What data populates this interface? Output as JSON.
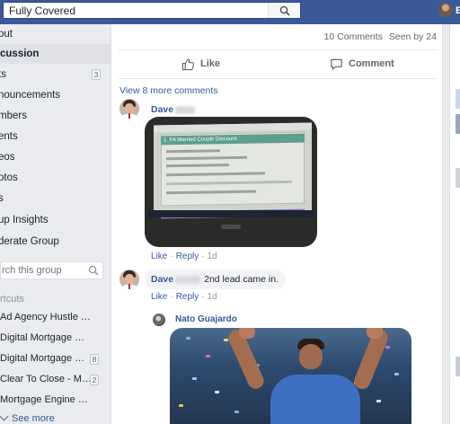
{
  "topbar": {
    "search_value": "Fully Covered",
    "profile_initial": "E"
  },
  "sidebar": {
    "items": [
      {
        "label": "out",
        "count": ""
      },
      {
        "label": "cussion",
        "count": "",
        "active": true
      },
      {
        "label": "ts",
        "count": "3"
      },
      {
        "label": "nouncements",
        "count": ""
      },
      {
        "label": "mbers",
        "count": ""
      },
      {
        "label": "ents",
        "count": ""
      },
      {
        "label": "eos",
        "count": ""
      },
      {
        "label": "otos",
        "count": ""
      },
      {
        "label": "s",
        "count": ""
      },
      {
        "label": "up Insights",
        "count": ""
      },
      {
        "label": "derate Group",
        "count": ""
      }
    ],
    "search_placeholder": "rch this group",
    "shortcuts_title": "rtcuts",
    "shortcuts": [
      {
        "label": "Ad Agency Hustle - The...",
        "count": ""
      },
      {
        "label": "Digital Mortgage Market...",
        "count": ""
      },
      {
        "label": "Digital Mortgage Mar...",
        "count": "8"
      },
      {
        "label": "Clear To Close - Me...",
        "count": "2"
      },
      {
        "label": "Mortgage Engine Lead ...",
        "count": ""
      }
    ],
    "see_more": "See more"
  },
  "post": {
    "comments_count": "10 Comments",
    "seen_by": "Seen by 24",
    "like_label": "Like",
    "comment_label": "Comment",
    "view_more_comments": "View 8 more comments",
    "photo_screen_title": "1. FA Married Couple Discount",
    "comments": [
      {
        "author": "Dave",
        "text": "",
        "like": "Like",
        "reply": "Reply",
        "time": "1d"
      },
      {
        "author": "Dave",
        "text": "2nd lead came in.",
        "like": "Like",
        "reply": "Reply",
        "time": "1d"
      }
    ],
    "reply": {
      "author": "Nato Guajardo"
    }
  },
  "colors": {
    "brand": "#3b5998",
    "link": "#365899",
    "background": "#e9ebee"
  }
}
